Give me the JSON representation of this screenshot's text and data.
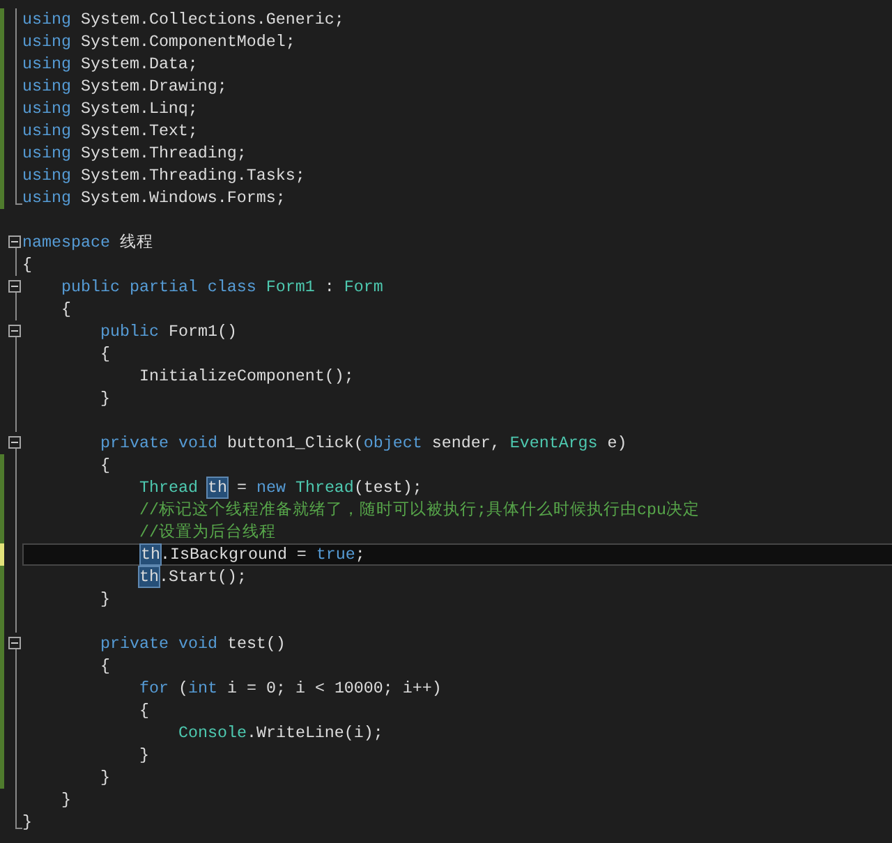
{
  "editor": {
    "blocks": [
      {
        "lines": [
          {
            "color": "#4f7b2d",
            "current": false,
            "tokens": [
              {
                "text": "using",
                "kind": "keyword"
              },
              {
                "text": " System.Collections.Generic;",
                "kind": "plain"
              }
            ]
          },
          {
            "color": "#4f7b2d",
            "current": false,
            "tokens": [
              {
                "text": "using",
                "kind": "keyword"
              },
              {
                "text": " System.ComponentModel;",
                "kind": "plain"
              }
            ]
          },
          {
            "color": "#4f7b2d",
            "current": false,
            "tokens": [
              {
                "text": "using",
                "kind": "keyword"
              },
              {
                "text": " System.Data;",
                "kind": "plain"
              }
            ]
          },
          {
            "color": "#4f7b2d",
            "current": false,
            "tokens": [
              {
                "text": "using",
                "kind": "keyword"
              },
              {
                "text": " System.Drawing;",
                "kind": "plain"
              }
            ]
          },
          {
            "color": "#4f7b2d",
            "current": false,
            "tokens": [
              {
                "text": "using",
                "kind": "keyword"
              },
              {
                "text": " System.Linq;",
                "kind": "plain"
              }
            ]
          },
          {
            "color": "#4f7b2d",
            "current": false,
            "tokens": [
              {
                "text": "using",
                "kind": "keyword"
              },
              {
                "text": " System.Text;",
                "kind": "plain"
              }
            ]
          },
          {
            "color": "#4f7b2d",
            "current": false,
            "tokens": [
              {
                "text": "using",
                "kind": "keyword"
              },
              {
                "text": " System.Threading;",
                "kind": "plain"
              }
            ]
          },
          {
            "color": "#4f7b2d",
            "current": false,
            "tokens": [
              {
                "text": "using",
                "kind": "keyword"
              },
              {
                "text": " System.Threading.Tasks;",
                "kind": "plain"
              }
            ]
          },
          {
            "color": "#4f7b2d",
            "current": false,
            "tokens": [
              {
                "text": "using",
                "kind": "keyword"
              },
              {
                "text": " System.Windows.Forms;",
                "kind": "plain"
              }
            ]
          }
        ]
      },
      {
        "lines": [
          {
            "current": false,
            "expanded": true,
            "tokens": [
              {
                "text": "namespace",
                "kind": "keyword"
              },
              {
                "text": " 线程",
                "kind": "plain"
              }
            ]
          },
          {
            "current": false,
            "tokens": [
              {
                "text": "{",
                "kind": "plain"
              }
            ],
            "children": [
              {
                "current": false,
                "expanded": true,
                "tokens": [
                  {
                    "text": "public partial class ",
                    "kind": "keyword"
                  },
                  {
                    "text": "Form1",
                    "kind": "type"
                  },
                  {
                    "text": " : ",
                    "kind": "plain"
                  },
                  {
                    "text": "Form",
                    "kind": "type"
                  }
                ]
              },
              {
                "current": false,
                "tokens": [
                  {
                    "text": "{",
                    "kind": "plain"
                  }
                ],
                "children": [
                  {
                    "current": false,
                    "expanded": true,
                    "tokens": [
                      {
                        "text": "public",
                        "kind": "keyword"
                      },
                      {
                        "text": " Form1()",
                        "kind": "plain"
                      }
                    ]
                  },
                  {
                    "current": false,
                    "tokens": [
                      {
                        "text": "{",
                        "kind": "plain"
                      }
                    ],
                    "children": [
                      {
                        "current": false,
                        "tokens": [
                          {
                            "text": "InitializeComponent();",
                            "kind": "plain"
                          }
                        ]
                      }
                    ]
                  },
                  {
                    "current": false,
                    "tokens": [
                      {
                        "text": "}",
                        "kind": "plain"
                      }
                    ]
                  },
                  {
                    "current": false
                  },
                  {
                    "current": false,
                    "expanded": true,
                    "tokens": [
                      {
                        "text": "private void",
                        "kind": "keyword"
                      },
                      {
                        "text": " button1_Click(",
                        "kind": "plain"
                      },
                      {
                        "text": "object",
                        "kind": "keyword"
                      },
                      {
                        "text": " sender, ",
                        "kind": "plain"
                      },
                      {
                        "text": "EventArgs",
                        "kind": "type"
                      },
                      {
                        "text": " e)",
                        "kind": "plain"
                      }
                    ]
                  },
                  {
                    "color": "#4f7b2d",
                    "current": false,
                    "tokens": [
                      {
                        "text": "{",
                        "kind": "plain"
                      }
                    ],
                    "children": [
                      {
                        "color": "#4f7b2d",
                        "current": false,
                        "tokens": [
                          {
                            "text": "Thread ",
                            "kind": "type"
                          },
                          {
                            "text": "th",
                            "kind": "reference"
                          },
                          {
                            "text": " = ",
                            "kind": "plain"
                          },
                          {
                            "text": "new ",
                            "kind": "keyword"
                          },
                          {
                            "text": "Thread",
                            "kind": "type"
                          },
                          {
                            "text": "(test);",
                            "kind": "plain"
                          }
                        ]
                      },
                      {
                        "color": "#4f7b2d",
                        "current": false,
                        "tokens": [
                          {
                            "text": "//标记这个线程准备就绪了，随时可以被执行;具体什么时候执行由cpu决定",
                            "kind": "comment"
                          }
                        ]
                      },
                      {
                        "color": "#4f7b2d",
                        "current": false,
                        "tokens": [
                          {
                            "text": "//设置为后台线程",
                            "kind": "comment"
                          }
                        ]
                      },
                      {
                        "color": "#e2e27a",
                        "current": true,
                        "tokens": [
                          {
                            "text": "th",
                            "kind": "reference"
                          },
                          {
                            "text": ".IsBackground = ",
                            "kind": "plain"
                          },
                          {
                            "text": "true",
                            "kind": "keyword"
                          },
                          {
                            "text": ";",
                            "kind": "plain"
                          }
                        ]
                      },
                      {
                        "color": "#4f7b2d",
                        "current": false,
                        "tokens": [
                          {
                            "text": "th",
                            "kind": "reference"
                          },
                          {
                            "text": ".Start();",
                            "kind": "plain"
                          }
                        ]
                      }
                    ]
                  },
                  {
                    "color": "#4f7b2d",
                    "current": false,
                    "tokens": [
                      {
                        "text": "}",
                        "kind": "plain"
                      }
                    ]
                  },
                  {
                    "color": "#4f7b2d",
                    "current": false
                  },
                  {
                    "color": "#4f7b2d",
                    "current": false,
                    "expanded": true,
                    "tokens": [
                      {
                        "text": "private void",
                        "kind": "keyword"
                      },
                      {
                        "text": " test()",
                        "kind": "plain"
                      }
                    ]
                  },
                  {
                    "color": "#4f7b2d",
                    "current": false,
                    "tokens": [
                      {
                        "text": "{",
                        "kind": "plain"
                      }
                    ],
                    "children": [
                      {
                        "color": "#4f7b2d",
                        "current": false,
                        "tokens": [
                          {
                            "text": "for",
                            "kind": "keyword"
                          },
                          {
                            "text": " (",
                            "kind": "plain"
                          },
                          {
                            "text": "int",
                            "kind": "keyword"
                          },
                          {
                            "text": " i = 0; i < 10000; i++)",
                            "kind": "plain"
                          }
                        ]
                      },
                      {
                        "color": "#4f7b2d",
                        "current": false,
                        "tokens": [
                          {
                            "text": "{",
                            "kind": "plain"
                          }
                        ],
                        "children": [
                          {
                            "color": "#4f7b2d",
                            "current": false,
                            "tokens": [
                              {
                                "text": "Console",
                                "kind": "type"
                              },
                              {
                                "text": ".WriteLine(i);",
                                "kind": "plain"
                              }
                            ]
                          }
                        ]
                      },
                      {
                        "color": "#4f7b2d",
                        "current": false,
                        "tokens": [
                          {
                            "text": "}",
                            "kind": "plain"
                          }
                        ]
                      }
                    ]
                  },
                  {
                    "color": "#4f7b2d",
                    "current": false,
                    "tokens": [
                      {
                        "text": "}",
                        "kind": "plain"
                      }
                    ]
                  }
                ]
              },
              {
                "current": false,
                "tokens": [
                  {
                    "text": "}",
                    "kind": "plain"
                  }
                ]
              }
            ]
          },
          {
            "current": false,
            "tokens": [
              {
                "text": "}",
                "kind": "plain"
              }
            ]
          }
        ]
      }
    ]
  }
}
